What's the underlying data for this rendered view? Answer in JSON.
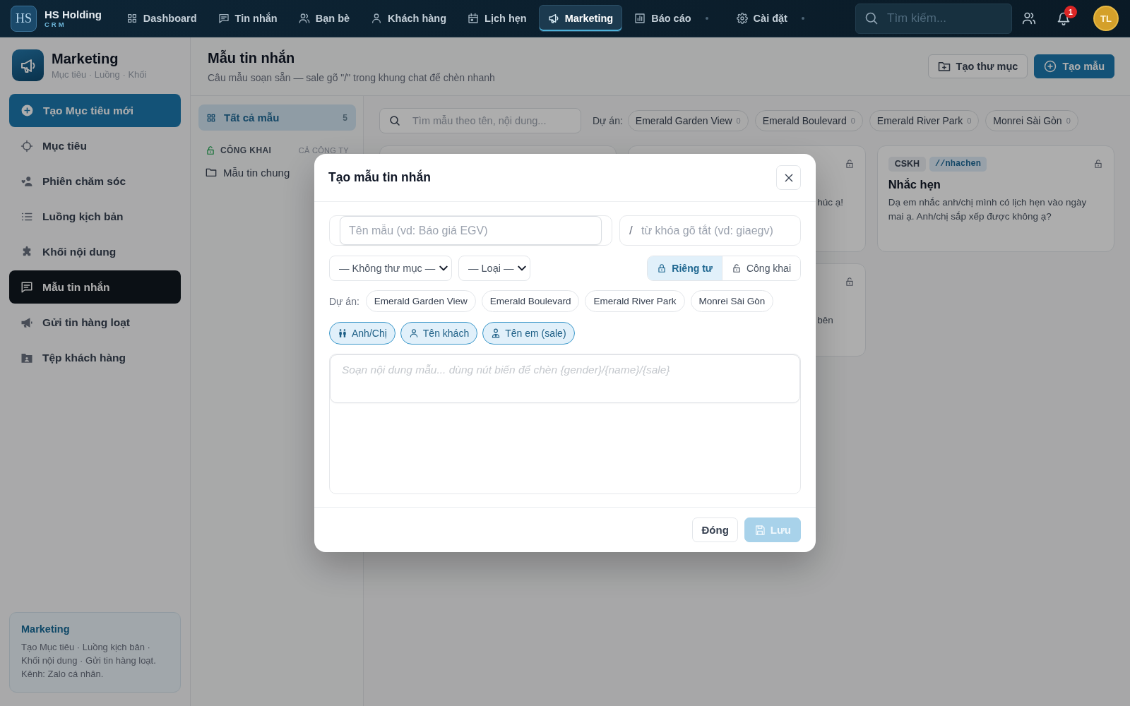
{
  "top_bar": {
    "logo": {
      "mark": "HS",
      "name": "HS Holding",
      "tagline": "CRM"
    },
    "nav": [
      {
        "label": "Dashboard",
        "selected": false,
        "has_submenu": false
      },
      {
        "label": "Tin nhắn",
        "selected": false,
        "has_submenu": false
      },
      {
        "label": "Bạn bè",
        "selected": false,
        "has_submenu": false
      },
      {
        "label": "Khách hàng",
        "selected": false,
        "has_submenu": false
      },
      {
        "label": "Lịch hẹn",
        "selected": false,
        "has_submenu": false
      },
      {
        "label": "Marketing",
        "selected": true,
        "has_submenu": false
      },
      {
        "label": "Báo cáo",
        "selected": false,
        "has_submenu": true
      },
      {
        "label": "Cài đặt",
        "selected": false,
        "has_submenu": true
      }
    ],
    "search": {
      "placeholder": "Tìm kiếm..."
    },
    "notifications": {
      "badge": "1"
    },
    "user": {
      "initials": "TL"
    }
  },
  "sidebar": {
    "module": {
      "title": "Marketing",
      "subtitle": "Mục tiêu · Luồng · Khối"
    },
    "create_button": "Tạo Mục tiêu mới",
    "items": [
      {
        "label": "Mục tiêu",
        "selected": false
      },
      {
        "label": "Phiên chăm sóc",
        "selected": false
      },
      {
        "label": "Luồng kịch bản",
        "selected": false
      },
      {
        "label": "Khối nội dung",
        "selected": false
      },
      {
        "label": "Mẫu tin nhắn",
        "selected": true
      },
      {
        "label": "Gửi tin hàng loạt",
        "selected": false
      },
      {
        "label": "Tệp khách hàng",
        "selected": false
      }
    ],
    "info_card": {
      "title": "Marketing",
      "text": "Tạo Mục tiêu · Luồng kịch bản · Khối nội dung · Gửi tin hàng loạt. Kênh: Zalo cá nhân."
    }
  },
  "page": {
    "title": "Mẫu tin nhắn",
    "subtitle": "Câu mẫu soạn sẵn — sale gõ \"/\" trong khung chat để chèn nhanh",
    "actions": [
      {
        "label": "Tạo thư mục",
        "kind": "secondary"
      },
      {
        "label": "Tạo mẫu",
        "kind": "primary"
      }
    ]
  },
  "folders": {
    "all": {
      "label": "Tất cả mẫu",
      "count": "5",
      "selected": true
    },
    "sections": [
      {
        "title": "CÔNG KHAI",
        "scope": "CẢ CÔNG TY",
        "folders": [
          {
            "label": "Mẫu tin chung",
            "selected": false
          }
        ]
      }
    ]
  },
  "filters": {
    "search": {
      "placeholder": "Tìm mẫu theo tên, nội dung..."
    },
    "project_label": "Dự án:",
    "projects": [
      {
        "name": "Emerald Garden View",
        "count": "0",
        "selected": false
      },
      {
        "name": "Emerald Boulevard",
        "count": "0",
        "selected": false
      },
      {
        "name": "Emerald River Park",
        "count": "0",
        "selected": false
      },
      {
        "name": "Monrei Sài Gòn",
        "count": "0",
        "selected": false
      }
    ]
  },
  "cards": [
    {
      "kind": "covered",
      "public": true,
      "text": "húc ạ!"
    },
    {
      "kind": "full",
      "public": true,
      "category": "CSKH",
      "shortcut": "//nhachen",
      "title": "Nhắc hẹn",
      "text": "Dạ em nhắc anh/chị mình có lịch hẹn vào ngày mai ạ. Anh/chị sắp xếp được không ạ?"
    },
    {
      "kind": "covered",
      "public": true,
      "text": "bên"
    }
  ],
  "modal": {
    "title": "Tạo mẫu tin nhắn",
    "name_field": {
      "placeholder": "Tên mẫu (vd: Báo giá EGV)"
    },
    "shortcut_field": {
      "prefix": "/",
      "placeholder": "từ khóa gõ tắt (vd: giaegv)"
    },
    "selects": [
      {
        "value": "— Không thư mục —"
      },
      {
        "value": "— Loại —"
      }
    ],
    "visibility": [
      {
        "label": "Riêng tư",
        "selected": true
      },
      {
        "label": "Công khai",
        "selected": false
      }
    ],
    "project_label": "Dự án:",
    "projects": [
      {
        "name": "Emerald Garden View",
        "selected": false
      },
      {
        "name": "Emerald Boulevard",
        "selected": false
      },
      {
        "name": "Emerald River Park",
        "selected": false
      },
      {
        "name": "Monrei Sài Gòn",
        "selected": false
      }
    ],
    "variables": [
      {
        "label": "Anh/Chị"
      },
      {
        "label": "Tên khách"
      },
      {
        "label": "Tên em (sale)"
      }
    ],
    "content_field": {
      "placeholder": "Soạn nội dung mẫu... dùng nút biến để chèn {gender}/{name}/{sale}"
    },
    "buttons": [
      {
        "label": "Đóng",
        "kind": "secondary",
        "disabled": false
      },
      {
        "label": "Lưu",
        "kind": "primary",
        "disabled": true
      }
    ]
  }
}
